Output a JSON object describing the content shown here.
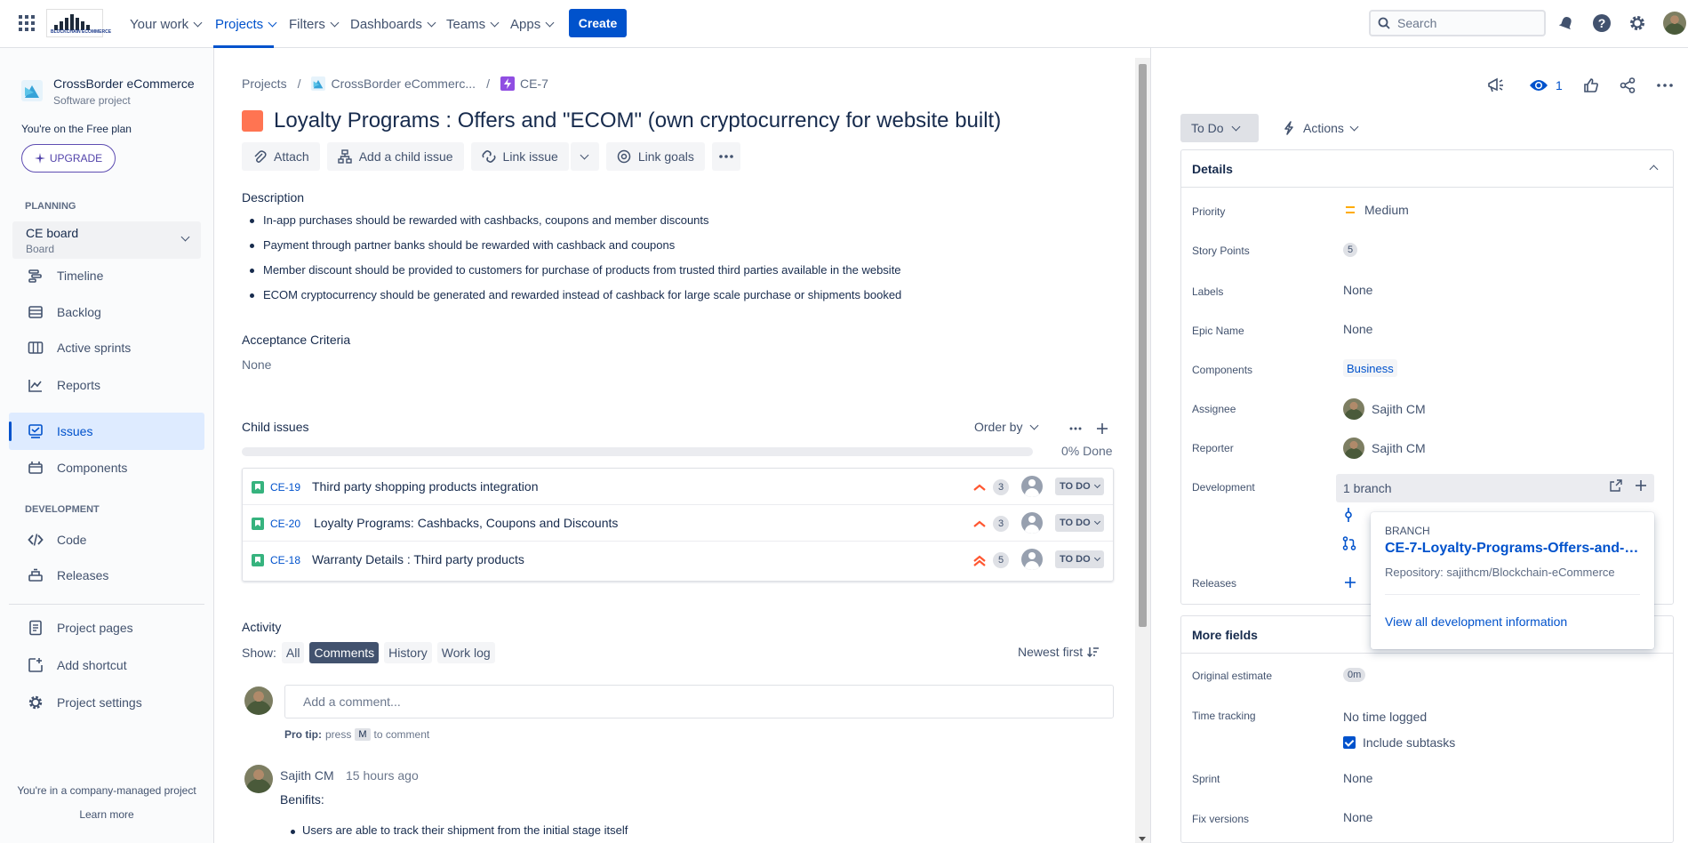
{
  "topnav": {
    "logo_text": "BLOCKCHAIN ECOMMERCE",
    "items": [
      {
        "label": "Your work"
      },
      {
        "label": "Projects"
      },
      {
        "label": "Filters"
      },
      {
        "label": "Dashboards"
      },
      {
        "label": "Teams"
      },
      {
        "label": "Apps"
      }
    ],
    "create_label": "Create",
    "search_placeholder": "Search",
    "icons": [
      "app-switcher-icon",
      "notifications-icon",
      "help-icon",
      "settings-icon",
      "profile-avatar"
    ]
  },
  "sidebar": {
    "project_name": "CrossBorder eCommerce",
    "project_type": "Software project",
    "free_plan": "You're on the Free plan",
    "upgrade_label": "UPGRADE",
    "planning_heading": "PLANNING",
    "board_name": "CE board",
    "board_sub": "Board",
    "planning_items": [
      {
        "label": "Timeline",
        "icon": "timeline-icon"
      },
      {
        "label": "Backlog",
        "icon": "backlog-icon"
      },
      {
        "label": "Active sprints",
        "icon": "active-sprints-icon"
      },
      {
        "label": "Reports",
        "icon": "reports-icon"
      },
      {
        "label": "Issues",
        "icon": "issues-icon"
      },
      {
        "label": "Components",
        "icon": "components-icon"
      }
    ],
    "development_heading": "DEVELOPMENT",
    "dev_items": [
      {
        "label": "Code",
        "icon": "code-icon"
      },
      {
        "label": "Releases",
        "icon": "releases-icon"
      }
    ],
    "bottom_items": [
      {
        "label": "Project pages",
        "icon": "project-pages-icon"
      },
      {
        "label": "Add shortcut",
        "icon": "add-shortcut-icon"
      },
      {
        "label": "Project settings",
        "icon": "gear-icon"
      }
    ],
    "company_managed": "You're in a company-managed project",
    "learn_more": "Learn more"
  },
  "breadcrumb": {
    "projects": "Projects",
    "project": "CrossBorder eCommerc...",
    "issue_key": "CE-7"
  },
  "issue": {
    "title": "Loyalty Programs : Offers and \"ECOM\" (own cryptocurrency for website built)",
    "actions": {
      "attach": "Attach",
      "add_child": "Add a child issue",
      "link_issue": "Link issue",
      "link_goals": "Link goals"
    },
    "description_label": "Description",
    "description": [
      "In-app purchases should be rewarded with cashbacks, coupons and member discounts",
      "Payment through partner banks should be rewarded with cashback and coupons",
      "Member discount should be provided to customers for purchase of products from trusted third parties available in the website",
      "ECOM cryptocurrency should be generated and rewarded instead of cashback for large scale purchase or shipments booked"
    ],
    "acceptance_label": "Acceptance Criteria",
    "acceptance_value": "None"
  },
  "child_issues": {
    "label": "Child issues",
    "order_by": "Order by",
    "progress_percent": 0,
    "progress_label": "0% Done",
    "rows": [
      {
        "key": "CE-19",
        "summary": "Third party shopping products integration",
        "priority": "high",
        "points": "3",
        "status": "TO DO"
      },
      {
        "key": "CE-20",
        "summary": "Loyalty Programs: Cashbacks, Coupons and Discounts",
        "priority": "high",
        "points": "3",
        "status": "TO DO"
      },
      {
        "key": "CE-18",
        "summary": "Warranty Details : Third party products",
        "priority": "highest",
        "points": "5",
        "status": "TO DO"
      }
    ]
  },
  "activity": {
    "label": "Activity",
    "show_label": "Show:",
    "tabs": [
      "All",
      "Comments",
      "History",
      "Work log"
    ],
    "active_tab": "Comments",
    "sort_label": "Newest first",
    "comment_placeholder": "Add a comment...",
    "protip_bold": "Pro tip:",
    "protip_press": "press",
    "protip_key": "M",
    "protip_rest": "to comment",
    "comment": {
      "author": "Sajith CM",
      "time": "15 hours ago",
      "body": "Benifits:",
      "list_item": "Users are able to track their shipment from the initial stage itself"
    }
  },
  "right_panel": {
    "watch_count": "1",
    "status": "To Do",
    "actions_label": "Actions",
    "details_heading": "Details",
    "fields": {
      "priority_label": "Priority",
      "priority_value": "Medium",
      "story_points_label": "Story Points",
      "story_points_value": "5",
      "labels_label": "Labels",
      "labels_value": "None",
      "epic_name_label": "Epic Name",
      "epic_name_value": "None",
      "components_label": "Components",
      "components_value": "Business",
      "assignee_label": "Assignee",
      "assignee_value": "Sajith CM",
      "reporter_label": "Reporter",
      "reporter_value": "Sajith CM",
      "development_label": "Development",
      "development_value": "1 branch",
      "releases_label": "Releases"
    },
    "popup": {
      "branch_label": "BRANCH",
      "branch_name": "CE-7-Loyalty-Programs-Offers-and-E...",
      "repository": "Repository: sajithcm/Blockchain-eCommerce",
      "view_all": "View all development information"
    },
    "more_fields": {
      "heading": "More fields",
      "original_estimate_label": "Original estimate",
      "original_estimate_value": "0m",
      "time_tracking_label": "Time tracking",
      "time_tracking_value": "No time logged",
      "include_subtasks": "Include subtasks",
      "sprint_label": "Sprint",
      "sprint_value": "None",
      "fix_versions_label": "Fix versions",
      "fix_versions_value": "None"
    }
  },
  "colors": {
    "brand_blue": "#0052cc",
    "epic_orange": "#ff7452",
    "story_green": "#36b37e",
    "priority_high": "#ff5630",
    "priority_medium": "#ffab00"
  }
}
